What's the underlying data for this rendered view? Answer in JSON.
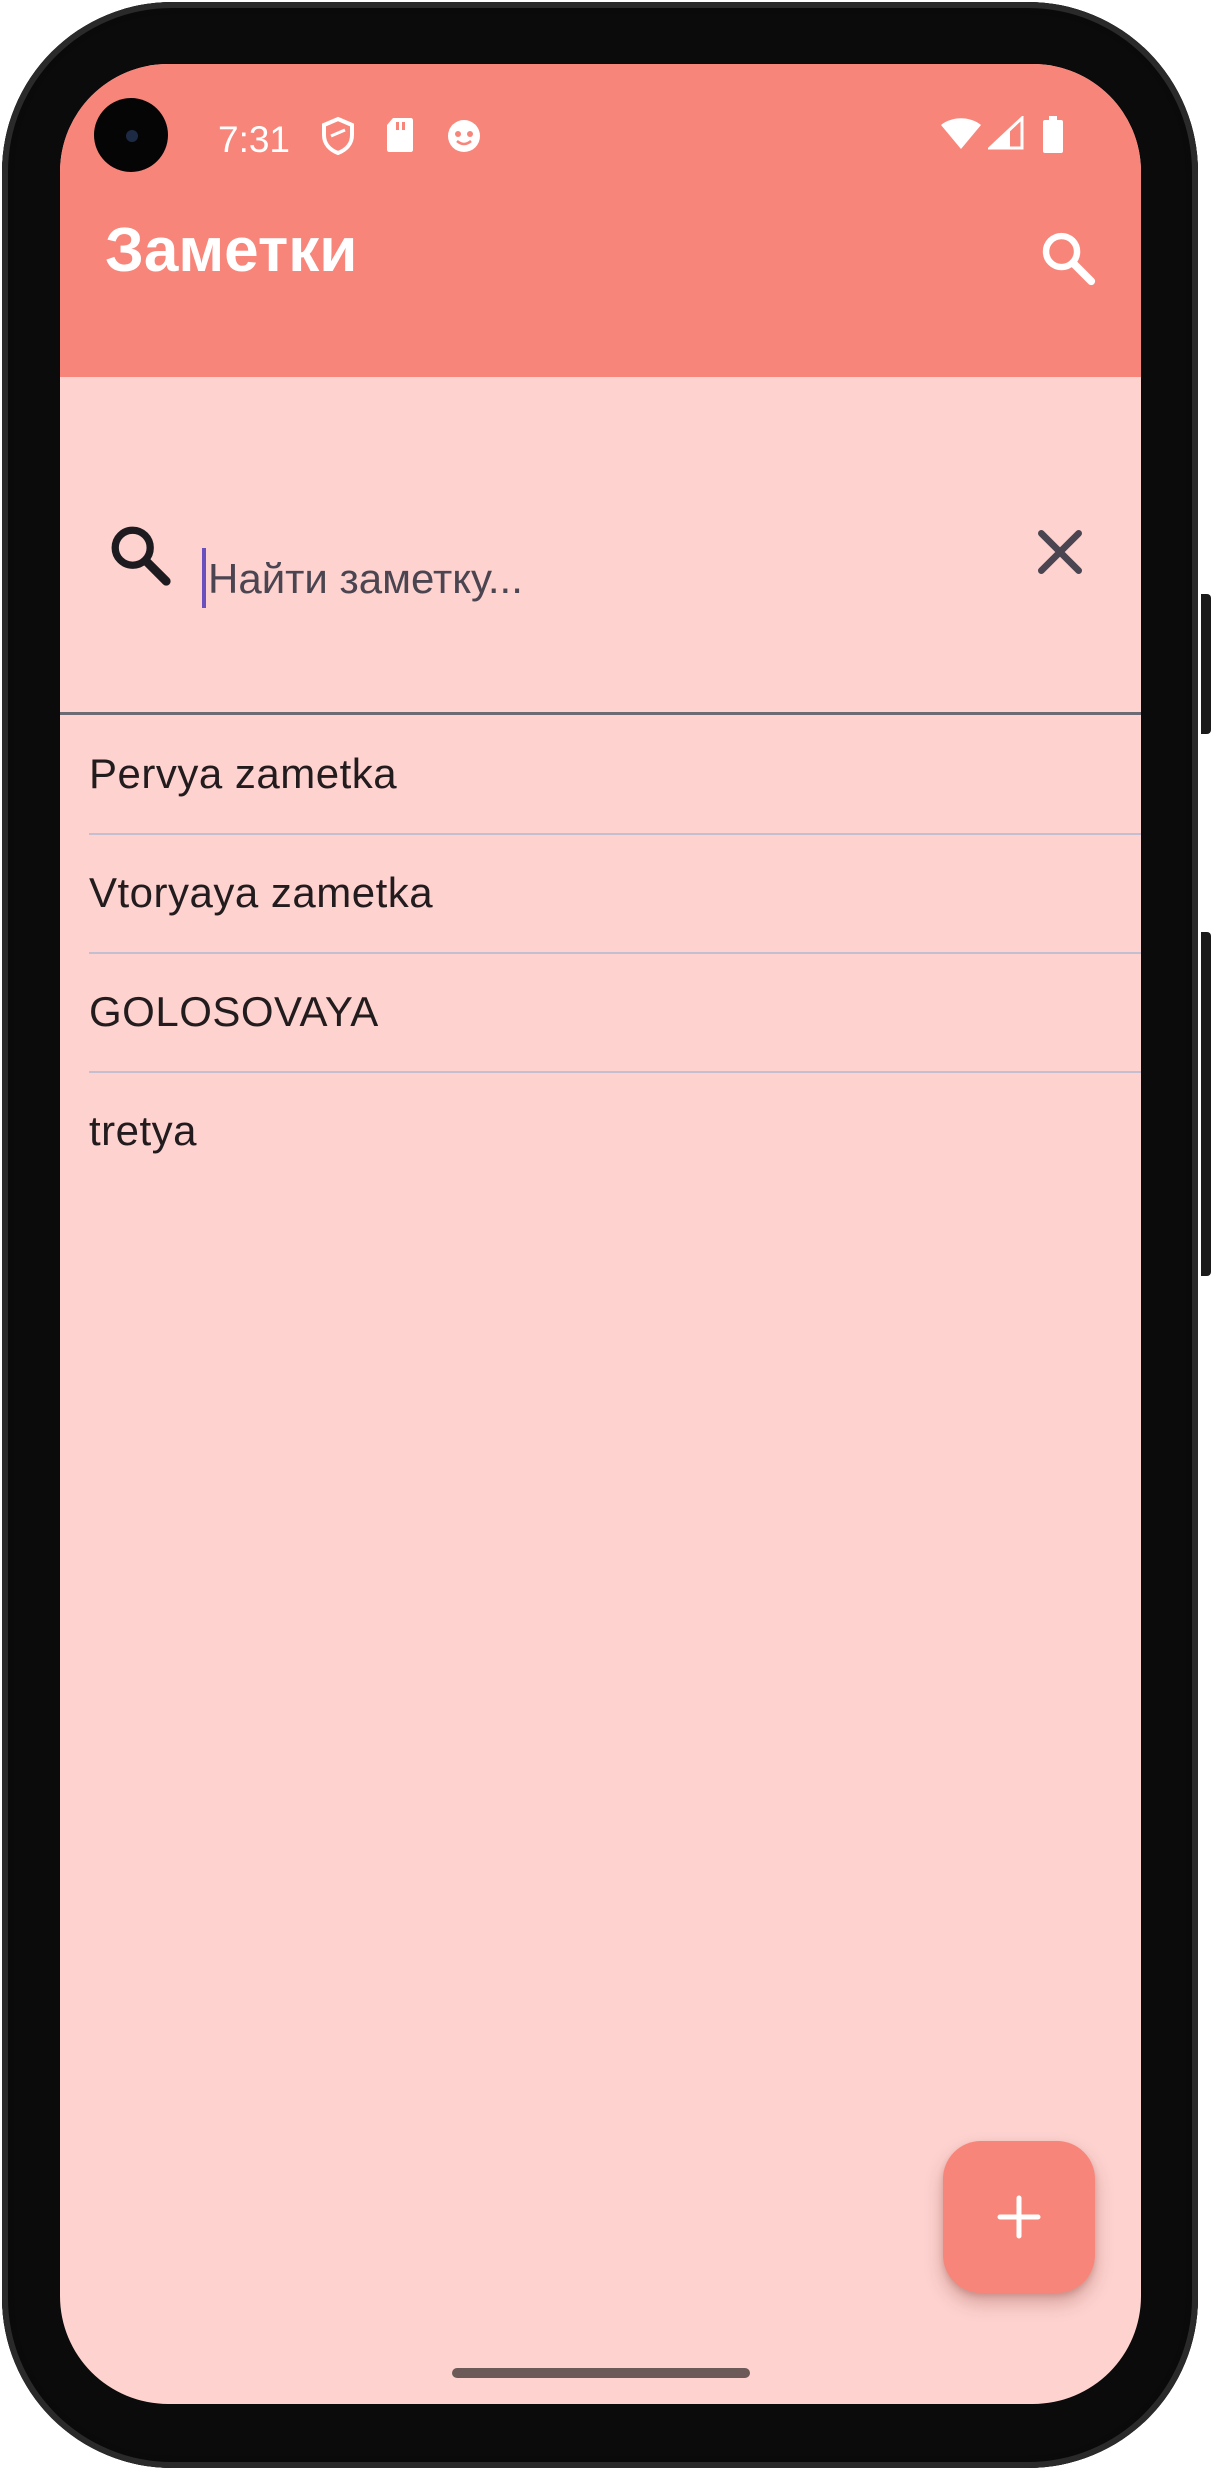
{
  "status_bar": {
    "time": "7:31"
  },
  "app_bar": {
    "title": "Заметки"
  },
  "search": {
    "placeholder": "Найти заметку...",
    "value": ""
  },
  "notes": [
    {
      "title": "Pervya zametka"
    },
    {
      "title": "Vtoryaya zametka"
    },
    {
      "title": "GOLOSOVAYA"
    },
    {
      "title": "tretya"
    }
  ],
  "fab": {
    "icon": "plus-icon"
  },
  "colors": {
    "app_bar": "#f8857a",
    "background": "#fdd2cf",
    "fab": "#f8857a",
    "caret": "#6a4fbf",
    "text": "#231c1e"
  }
}
